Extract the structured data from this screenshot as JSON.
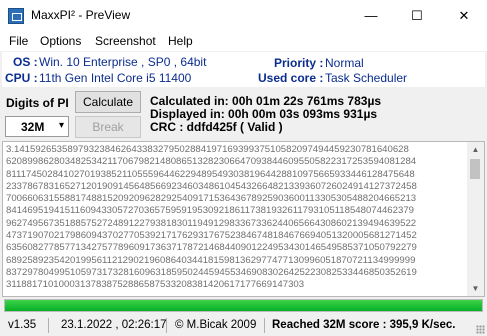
{
  "window": {
    "title": "MaxxPI² - PreView",
    "controls": {
      "minimize": "—",
      "maximize": "☐",
      "close": "✕"
    }
  },
  "menu": [
    "File",
    "Options",
    "Screenshot",
    "Help"
  ],
  "system": {
    "os_label": "OS :",
    "os_value": "Win. 10 Enterprise , SP0 , 64bit",
    "cpu_label": "CPU :",
    "cpu_value": "11th Gen Intel Core i5 11400",
    "priority_label": "Priority :",
    "priority_value": "Normal",
    "core_label": "Used core :",
    "core_value": "Task Scheduler"
  },
  "controls": {
    "digits_label": "Digits of PI",
    "digits_selected": "32M",
    "calculate_label": "Calculate",
    "break_label": "Break"
  },
  "results": {
    "calculated": "Calculated in: 00h 01m 22s 761ms 783µs",
    "displayed": "Displayed  in: 00h 00m 03s 093ms 931µs",
    "crc": "CRC : ddfd425f ( Valid )"
  },
  "digits_lines": [
    "3.14159265358979323846264338327950288419716939937510582097494459230781640628",
    "62089986280348253421170679821480865132823066470938446095505822317253594081284",
    "81117450284102701938521105559644622948954930381964428810975665933446128475648",
    "23378678316527120190914564856692346034861045432664821339360726024914127372458",
    "70066063155881748815209209628292540917153643678925903600113305305488204665213",
    "84146951941511609433057270365759591953092186117381932611793105118548074462379",
    "96274956735188575272489122793818301194912983367336244065664308602139494639522",
    "47371907021798609437027705392171762931767523846748184676694051320005681271452",
    "63560827785771342757789609173637178721468440901224953430146549585371050792279",
    "68925892354201995611212902196086403441815981362977477130996051870721134999999",
    "83729780499510597317328160963185950244594553469083026425223082533446850352619",
    "31188171010003137838752886587533208381420617177669147303"
  ],
  "progress_percent": 100,
  "status": {
    "version": "v1.35",
    "datetime": "23.1.2022 , 02:26:17",
    "copyright": "© M.Bicak 2009",
    "score": "Reached 32M score : 395,9 K/sec."
  },
  "colors": {
    "label_blue": "#0b2d8f",
    "progress_green": "#06b025"
  },
  "icons": {
    "combo_arrow": "chevron-down-icon",
    "scroll_up": "arrow-up-icon",
    "scroll_down": "arrow-down-icon"
  }
}
